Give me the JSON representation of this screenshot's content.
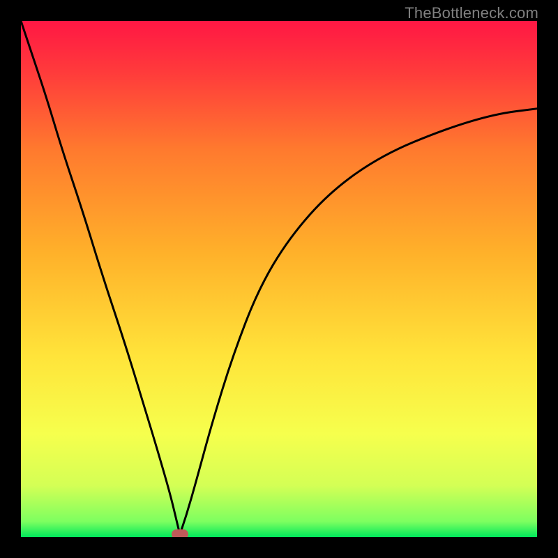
{
  "watermark": "TheBottleneck.com",
  "chart_data": {
    "type": "line",
    "title": "",
    "xlabel": "",
    "ylabel": "",
    "xlim": [
      0,
      100
    ],
    "ylim": [
      0,
      100
    ],
    "grid": false,
    "legend": false,
    "gradient_stops": [
      {
        "offset": 0.0,
        "color": "#ff1744"
      },
      {
        "offset": 0.1,
        "color": "#ff3b3b"
      },
      {
        "offset": 0.25,
        "color": "#ff7a2e"
      },
      {
        "offset": 0.45,
        "color": "#ffb12a"
      },
      {
        "offset": 0.65,
        "color": "#ffe43a"
      },
      {
        "offset": 0.8,
        "color": "#f6ff4d"
      },
      {
        "offset": 0.9,
        "color": "#d4ff55"
      },
      {
        "offset": 0.97,
        "color": "#7dff60"
      },
      {
        "offset": 1.0,
        "color": "#00e85b"
      }
    ],
    "series": [
      {
        "name": "left-branch",
        "x": [
          0,
          2,
          5,
          8,
          12,
          16,
          20,
          24,
          27,
          29,
          30.2,
          30.8
        ],
        "y": [
          100,
          94,
          85,
          75,
          63,
          50,
          38,
          25,
          15,
          8,
          3,
          0.5
        ]
      },
      {
        "name": "right-branch",
        "x": [
          30.8,
          32,
          34,
          37,
          41,
          46,
          52,
          60,
          70,
          82,
          92,
          100
        ],
        "y": [
          0.5,
          4,
          11,
          22,
          35,
          48,
          58,
          67,
          74,
          79,
          82,
          83
        ]
      }
    ],
    "min_marker": {
      "x": 30.8,
      "y": 0.5,
      "color": "#c05a5a"
    },
    "curve_color": "#000000",
    "curve_width": 3
  }
}
